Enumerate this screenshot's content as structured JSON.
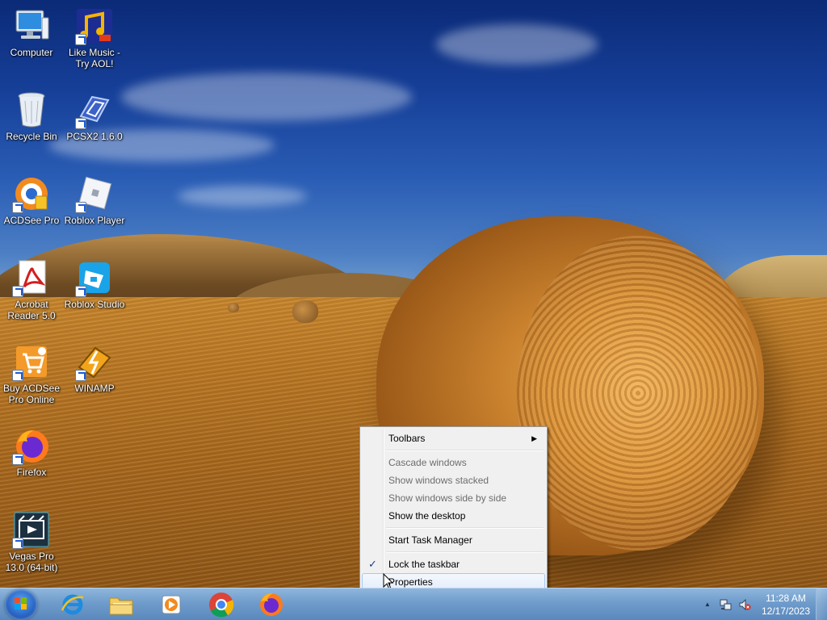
{
  "desktop": {
    "icons": [
      {
        "label": "Computer",
        "icon": "computer-icon"
      },
      {
        "label": "Like Music - Try AOL!",
        "icon": "music-icon"
      },
      {
        "label": "Recycle Bin",
        "icon": "recycle-bin-icon"
      },
      {
        "label": "PCSX2 1.6.0",
        "icon": "pcsx2-icon"
      },
      {
        "label": "ACDSee Pro",
        "icon": "acdsee-icon"
      },
      {
        "label": "Roblox Player",
        "icon": "roblox-player-icon"
      },
      {
        "label": "Acrobat Reader 5.0",
        "icon": "acrobat-icon"
      },
      {
        "label": "Roblox Studio",
        "icon": "roblox-studio-icon"
      },
      {
        "label": "Buy ACDSee Pro Online",
        "icon": "acdsee-cart-icon"
      },
      {
        "label": "WINAMP",
        "icon": "winamp-icon"
      },
      {
        "label": "Firefox",
        "icon": "firefox-icon"
      },
      {
        "label": "Vegas Pro 13.0 (64-bit)",
        "icon": "vegas-icon"
      }
    ]
  },
  "context_menu": {
    "toolbars": "Toolbars",
    "cascade": "Cascade windows",
    "stacked": "Show windows stacked",
    "side_by_side": "Show windows side by side",
    "show_desktop": "Show the desktop",
    "task_manager": "Start Task Manager",
    "lock_taskbar": "Lock the taskbar",
    "properties": "Properties",
    "lock_checked": true,
    "submenu_glyph": "▶",
    "check_glyph": "✓"
  },
  "taskbar": {
    "pinned": [
      {
        "name": "internet-explorer",
        "icon": "internet-explorer-icon"
      },
      {
        "name": "windows-explorer",
        "icon": "folder-icon"
      },
      {
        "name": "media-player",
        "icon": "media-player-icon"
      },
      {
        "name": "chrome",
        "icon": "chrome-icon"
      },
      {
        "name": "firefox",
        "icon": "firefox-icon"
      }
    ],
    "tray": {
      "show_hidden_glyph": "▲",
      "time": "11:28 AM",
      "date": "12/17/2023"
    }
  },
  "colors": {
    "taskbar_top": "#8fb6dc",
    "taskbar_bottom": "#5a88bd",
    "menu_bg": "#f0f0f0",
    "menu_hover_border": "#a8c8ef",
    "disabled_text": "#6d6d6d"
  }
}
